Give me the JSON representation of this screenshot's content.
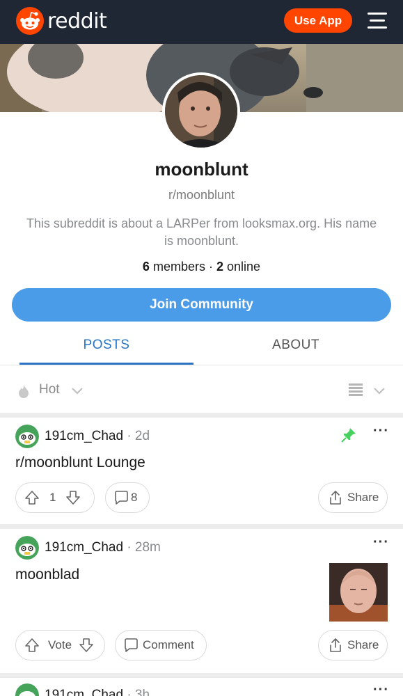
{
  "header": {
    "brand": "reddit",
    "use_app_label": "Use App",
    "menu_icon": "hamburger-menu-icon",
    "brand_color": "#ff4500",
    "bar_color": "#1f2735"
  },
  "community": {
    "name": "moonblunt",
    "subreddit": "r/moonblunt",
    "description": "This subreddit is about a LARPer from looksmax.org. His name is moonblunt.",
    "members_count": "6",
    "members_label": "members",
    "online_count": "2",
    "online_label": "online",
    "join_label": "Join Community",
    "accent_color": "#4a9ce8"
  },
  "tabs": [
    {
      "label": "POSTS",
      "active": true
    },
    {
      "label": "ABOUT",
      "active": false
    }
  ],
  "sort": {
    "label": "Hot",
    "icon": "flame-icon",
    "view_icon": "card-view-icon"
  },
  "posts": [
    {
      "user": "191cm_Chad",
      "time": "2d",
      "title": "r/moonblunt Lounge",
      "pinned": true,
      "votes": "1",
      "comments": "8",
      "share_label": "Share"
    },
    {
      "user": "191cm_Chad",
      "time": "28m",
      "title": "moonblad",
      "pinned": false,
      "votes": "Vote",
      "comments": "Comment",
      "share_label": "Share",
      "has_thumbnail": true
    },
    {
      "user": "191cm_Chad",
      "time": "3h"
    }
  ]
}
